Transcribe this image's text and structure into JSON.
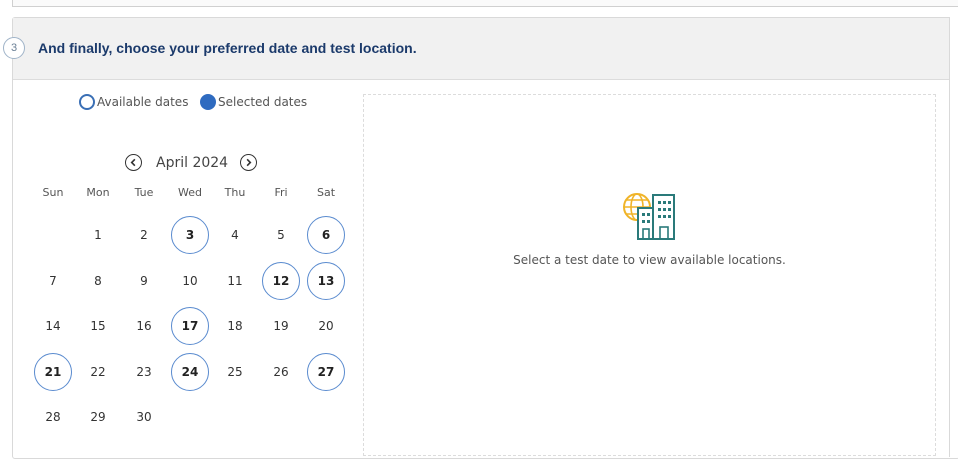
{
  "step": {
    "number": "3",
    "title": "And finally, choose your preferred date and test location."
  },
  "legend": {
    "available_label": "Available dates",
    "selected_label": "Selected dates"
  },
  "calendar": {
    "month_label": "April 2024",
    "weekdays": [
      "Sun",
      "Mon",
      "Tue",
      "Wed",
      "Thu",
      "Fri",
      "Sat"
    ],
    "first_weekday_index": 1,
    "days_in_month": 30,
    "available_days": [
      3,
      6,
      12,
      13,
      17,
      21,
      24,
      27
    ]
  },
  "locations": {
    "icon": "globe-buildings-icon",
    "message": "Select a test date to view available locations."
  },
  "colors": {
    "title": "#1b3a6b",
    "available_ring": "#5a8bcf",
    "selected_fill": "#2f6bc0",
    "icon_globe": "#f0b429",
    "icon_building": "#2a7a7a"
  }
}
